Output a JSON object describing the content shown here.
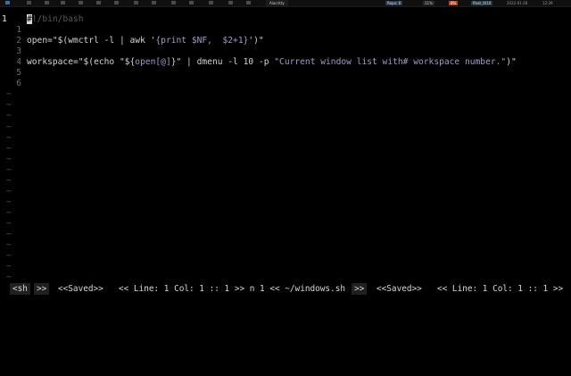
{
  "taskbar": {
    "window_title": "Alacritty",
    "widgets": [
      "Repo: 8",
      "11%",
      "8%",
      "Pixel_9/10",
      "2022-01-28",
      "12:39"
    ]
  },
  "editor": {
    "current_line": "1",
    "lines": [
      {
        "num": "",
        "parts": [
          {
            "t": "#",
            "c": "cursor"
          },
          {
            "t": "!/bin/bash",
            "c": "comment"
          }
        ]
      },
      {
        "num": "1",
        "parts": []
      },
      {
        "num": "2",
        "parts": [
          {
            "t": "open=\"$(wmctrl -l | awk '",
            "c": "code"
          },
          {
            "t": "{print $NF,  $2+1}",
            "c": "str"
          },
          {
            "t": "')\"",
            "c": "code"
          }
        ]
      },
      {
        "num": "3",
        "parts": []
      },
      {
        "num": "4",
        "parts": [
          {
            "t": "workspace=\"$(echo \"${",
            "c": "code"
          },
          {
            "t": "open[@]",
            "c": "str"
          },
          {
            "t": "}\" | dmenu -l 10 -p ",
            "c": "code"
          },
          {
            "t": "\"Current window list with# workspace number.\"",
            "c": "str"
          },
          {
            "t": ")\"",
            "c": "code"
          }
        ]
      },
      {
        "num": "5",
        "parts": []
      },
      {
        "num": "6",
        "parts": []
      }
    ],
    "tilde": "~",
    "tilde_count": 18
  },
  "statusline": {
    "mode": "<sh",
    "sep1": ">>",
    "saved_left": "<<Saved>>",
    "pos_left": "<< Line: 1 Col: 1 :: 1 >> n 1 << ~/windows.sh",
    "sep2": ">>",
    "saved_right": "<<Saved>>",
    "pos_right": "<< Line: 1 Col: 1 :: 1 >>"
  },
  "colors": {
    "background": "#000000",
    "comment": "#5a5a5a",
    "string": "#a898c6",
    "linenr": "#6a6a6a",
    "tilde": "#4f4f4f"
  }
}
